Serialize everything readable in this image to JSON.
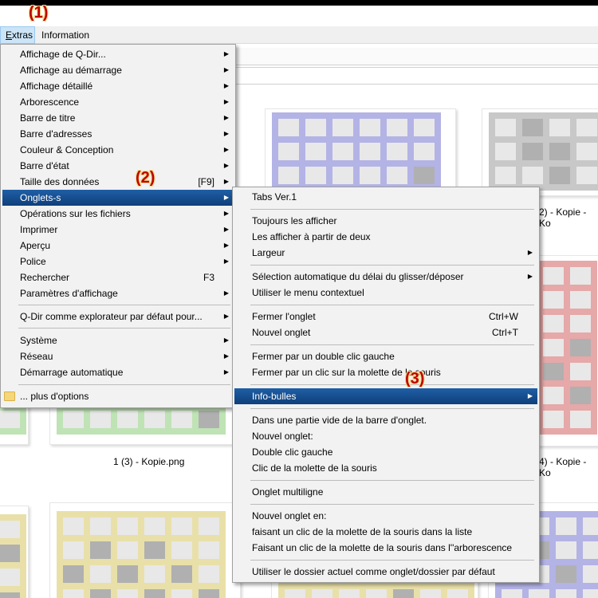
{
  "annotations": [
    "(1)",
    "(2)",
    "(3)"
  ],
  "menubar": {
    "extras_accel": "E",
    "extras_rest": "xtras",
    "information": "Information"
  },
  "thumb_labels": [
    "1 (3) - Kopie.png",
    "2) - Kopie - Ko",
    "4) - Kopie - Ko"
  ],
  "extras_menu": [
    "Affichage de Q-Dir...",
    "Affichage au démarrage",
    "Affichage détaillé",
    "Arborescence",
    "Barre de titre",
    "Barre d'adresses",
    "Couleur & Conception",
    "Barre d'état",
    "Taille des données",
    "Onglets-s",
    "Opérations sur les fichiers",
    "Imprimer",
    "Aperçu",
    "Police",
    "Rechercher",
    "Paramètres d'affichage",
    "Q-Dir comme explorateur par défaut pour...",
    "Système",
    "Réseau",
    "Démarrage automatique",
    "... plus d'options"
  ],
  "extras_shortcuts": {
    "taille": "[F9]",
    "rechercher": "F3"
  },
  "tabs_menu": [
    "Tabs Ver.1",
    "Toujours les afficher",
    "Les afficher à partir de deux",
    "Largeur",
    "Sélection automatique du délai du glisser/déposer",
    "Utiliser le menu contextuel",
    "Fermer l'onglet",
    "Nouvel onglet",
    "Fermer par un double clic gauche",
    "Fermer par un clic sur la molette de la souris",
    "Info-bulles",
    "Dans une partie vide de la barre d'onglet.",
    "Nouvel onglet:",
    "Double clic gauche",
    "Clic de la molette de la souris",
    "Onglet multiligne",
    "Nouvel onglet en:",
    "faisant un clic de la molette de la souris dans la liste",
    "Faisant un clic de la molette de la souris dans l''arborescence",
    "Utiliser le dossier actuel comme onglet/dossier par défaut"
  ],
  "tabs_shortcuts": {
    "fermer": "Ctrl+W",
    "nouvel": "Ctrl+T"
  },
  "colors": {
    "highlight": "#1f5fa6",
    "annotation": "#c00000",
    "menu_bg": "#f2f2f2"
  }
}
